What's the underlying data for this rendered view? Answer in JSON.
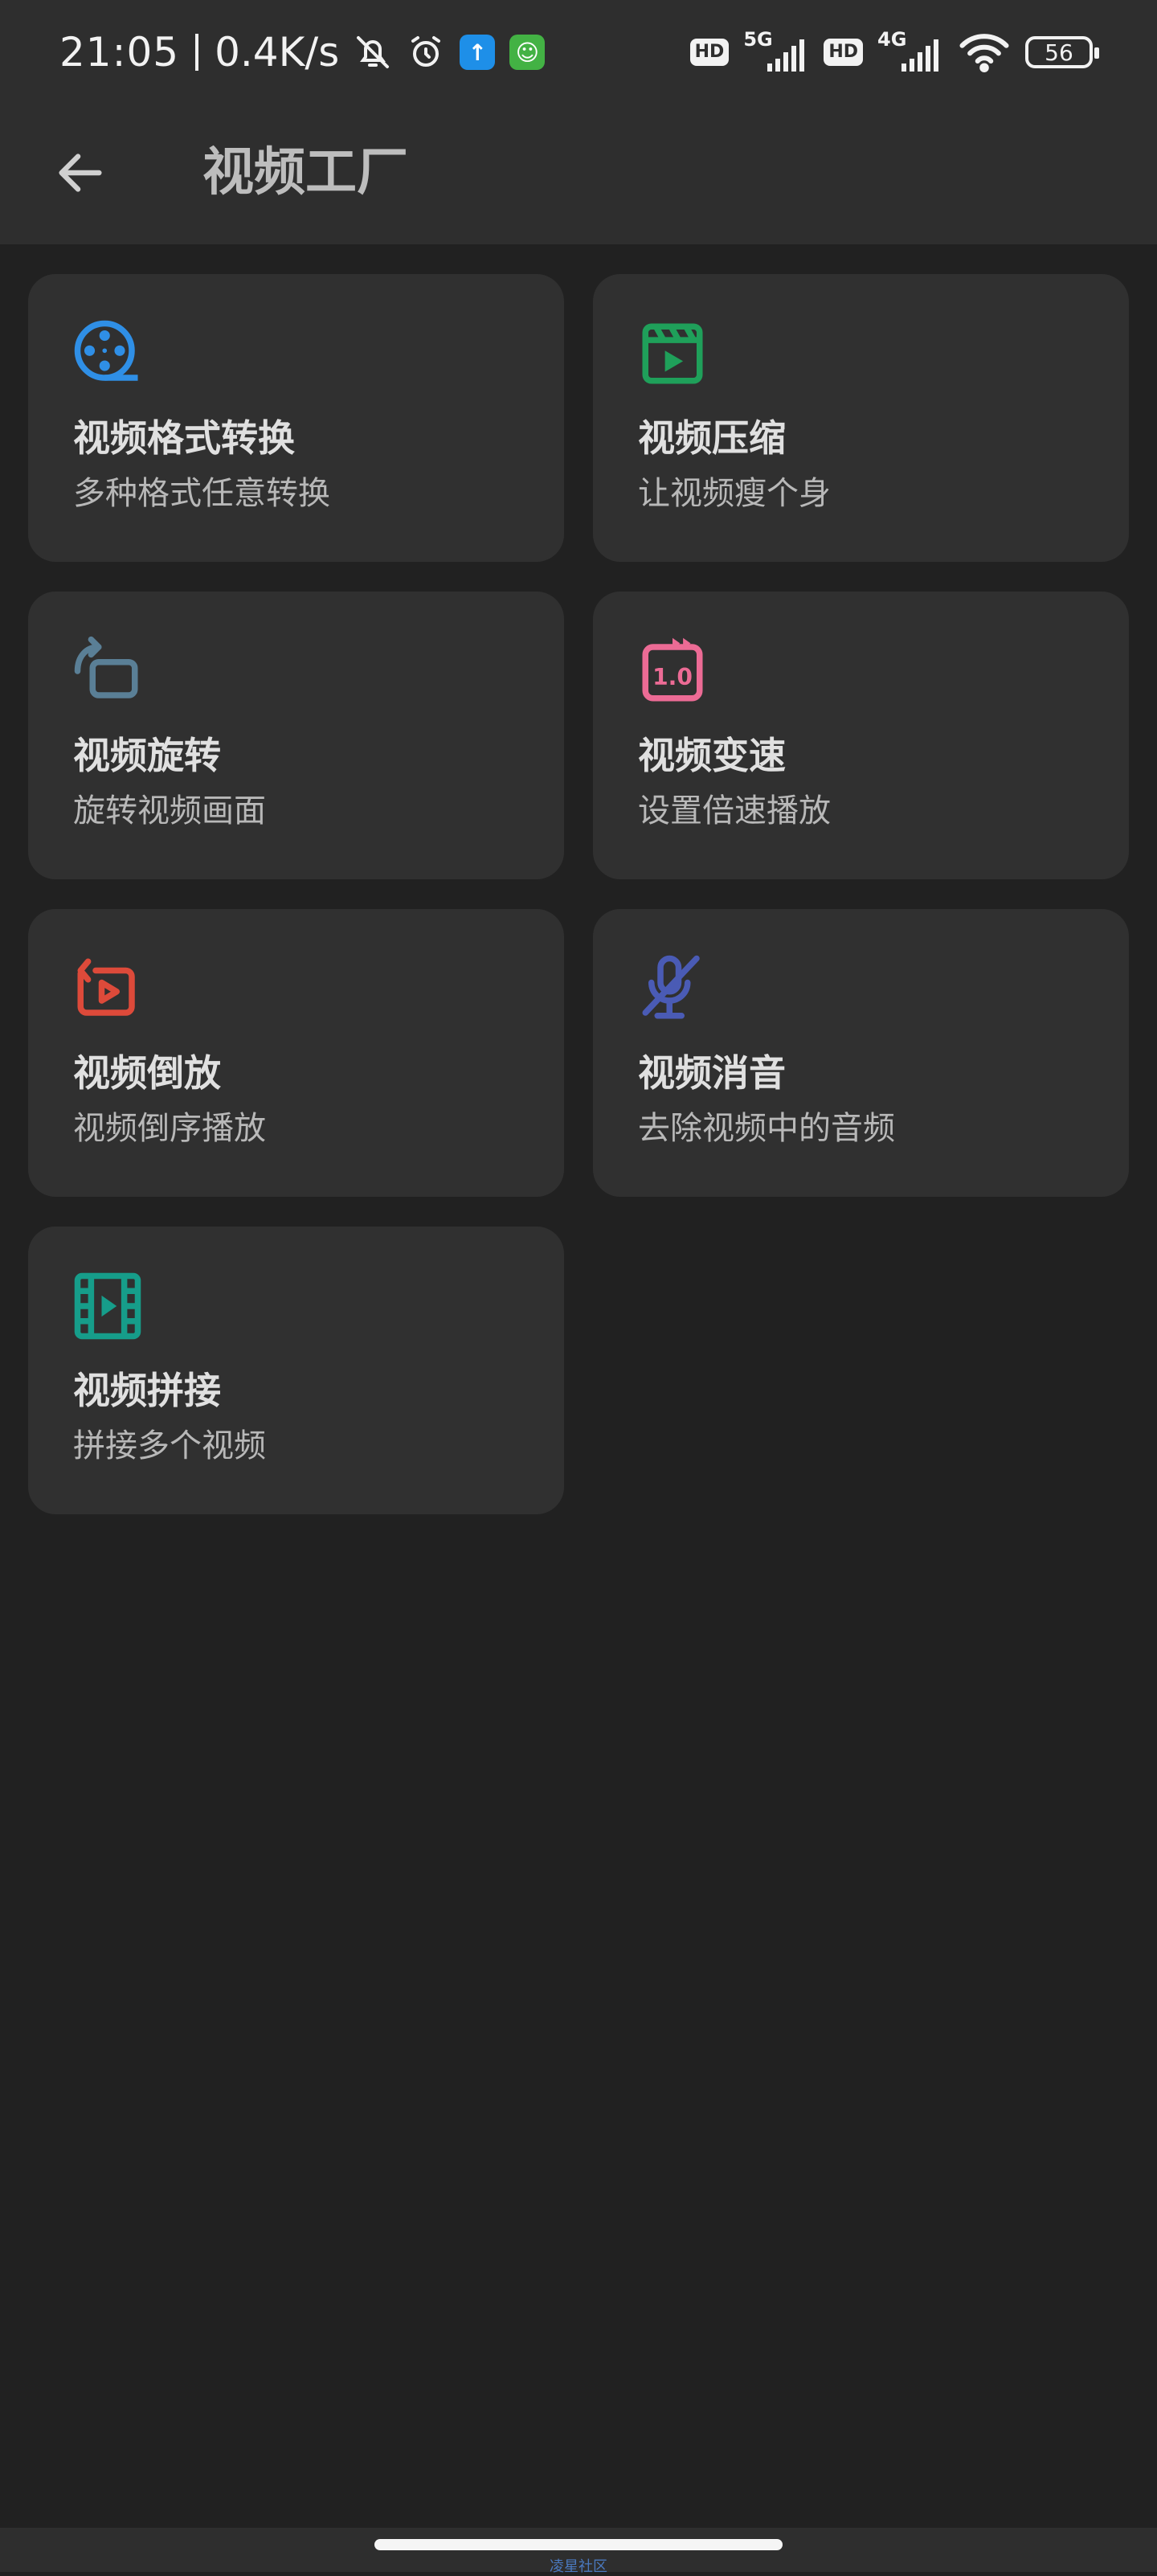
{
  "status_bar": {
    "time": "21:05",
    "speed": "0.4K/s",
    "hd_label": "HD",
    "net1_label": "5G",
    "net2_label": "4G",
    "battery": "56"
  },
  "app_bar": {
    "title": "视频工厂"
  },
  "tools": [
    {
      "title": "视频格式转换",
      "subtitle": "多种格式任意转换",
      "icon": "film-reel-icon",
      "color": "#2f8fe6"
    },
    {
      "title": "视频压缩",
      "subtitle": "让视频瘦个身",
      "icon": "video-clapper-icon",
      "color": "#1fa05a"
    },
    {
      "title": "视频旋转",
      "subtitle": "旋转视频画面",
      "icon": "rotate-icon",
      "color": "#5a7f96"
    },
    {
      "title": "视频变速",
      "subtitle": "设置倍速播放",
      "icon": "speed-icon",
      "color": "#ec6b95"
    },
    {
      "title": "视频倒放",
      "subtitle": "视频倒序播放",
      "icon": "reverse-play-icon",
      "color": "#dd4a3a"
    },
    {
      "title": "视频消音",
      "subtitle": "去除视频中的音频",
      "icon": "mic-off-icon",
      "color": "#4a5bb5"
    },
    {
      "title": "视频拼接",
      "subtitle": "拼接多个视频",
      "icon": "film-strip-icon",
      "color": "#169d8a"
    }
  ],
  "nav": {
    "watermark": "凌星社区"
  }
}
